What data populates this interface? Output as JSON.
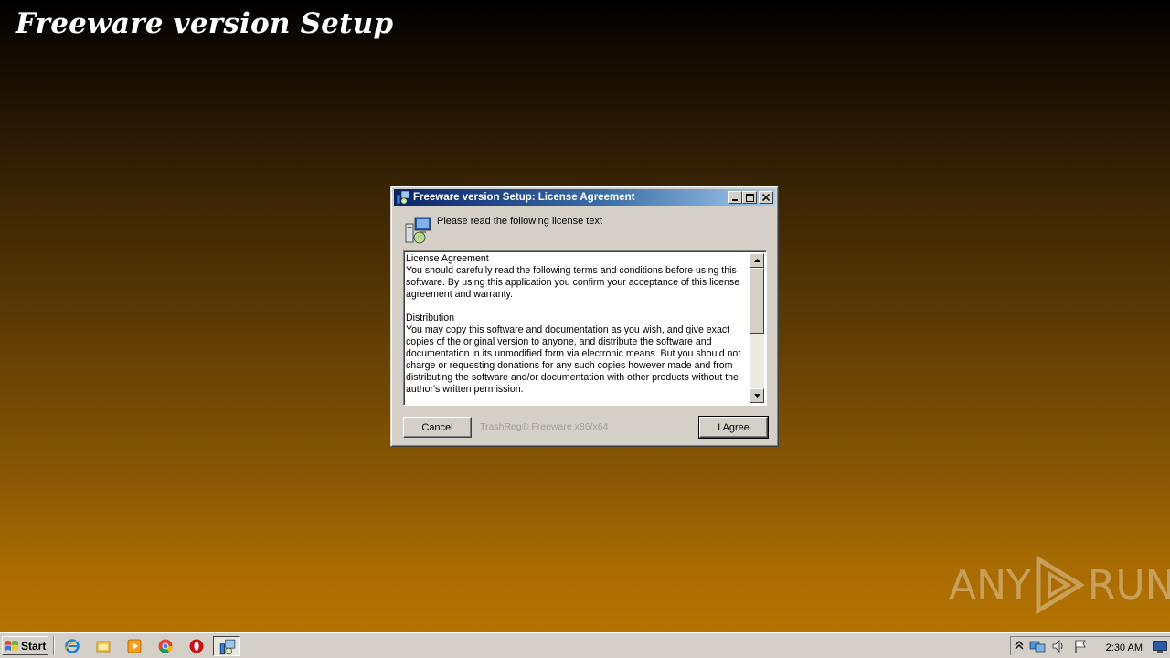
{
  "desktop": {
    "banner_title": "Freeware version Setup"
  },
  "dialog": {
    "title": "Freeware version Setup: License Agreement",
    "header_text": "Please read the following license text",
    "license_text": "License Agreement\nYou should carefully read the following terms and conditions before using this software. By using this application you confirm your acceptance of this license agreement and warranty.\n\nDistribution\nYou may copy this software and documentation as you wish, and give exact copies of the original version to anyone, and distribute the software and documentation in its unmodified form via electronic means. But you should not charge or requesting donations for any such copies however made and from distributing the software and/or documentation with other products without the author's written permission.",
    "cancel_label": "Cancel",
    "agree_label": "I Agree",
    "brand_text": "TrashReg® Freeware x86/x64",
    "scroll_position": 0.0
  },
  "watermark": {
    "left": "ANY",
    "right": "RUN"
  },
  "taskbar": {
    "start_label": "Start",
    "pinned_icons": [
      "internet-explorer-icon",
      "file-explorer-icon",
      "media-player-icon",
      "chrome-icon",
      "opera-icon",
      "setup-app-icon"
    ],
    "clock": "2:30 AM"
  },
  "colors": {
    "title_gradient_start": "#0a246a",
    "title_gradient_end": "#a6caf0",
    "desktop_bottom": "#bb7600",
    "dialog_face": "#d4d0c8"
  }
}
